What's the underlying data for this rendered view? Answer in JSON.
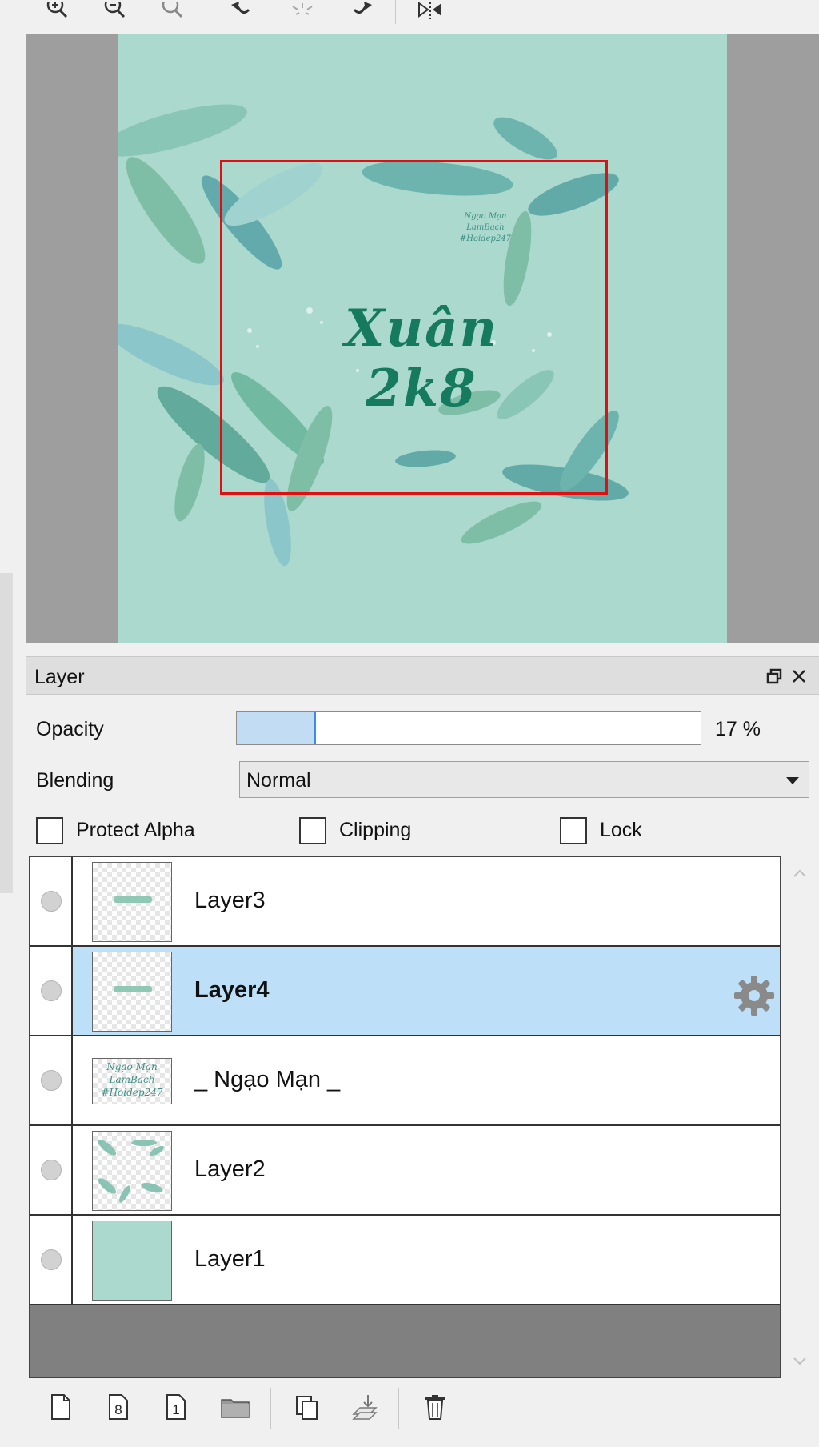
{
  "toolbar": {
    "icons": [
      "zoom-in-icon",
      "zoom-out-icon",
      "zoom-reset-icon",
      "rotate-left-icon",
      "rotate-reset-icon",
      "rotate-right-icon",
      "flip-horizontal-icon"
    ]
  },
  "canvas": {
    "artwork_title": "Xuân 2k8",
    "signature_lines": [
      "Ngạo Mạn",
      "LamBach",
      "#Hoidep247"
    ],
    "background_color": "#acd9ce",
    "navigator_frame_color": "#e01010"
  },
  "layer_panel": {
    "title": "Layer",
    "opacity_label": "Opacity",
    "opacity_value": "17 %",
    "opacity_fraction": 0.17,
    "blending_label": "Blending",
    "blending_value": "Normal",
    "protect_alpha_label": "Protect Alpha",
    "clipping_label": "Clipping",
    "lock_label": "Lock",
    "selection_color": "#bde0f8",
    "layers": [
      {
        "name": "Layer3",
        "selected": false,
        "thumb": "small-text"
      },
      {
        "name": "Layer4",
        "selected": true,
        "thumb": "small-text"
      },
      {
        "name": "_ Ngạo Mạn _",
        "selected": false,
        "thumb": "signature"
      },
      {
        "name": "Layer2",
        "selected": false,
        "thumb": "feathers"
      },
      {
        "name": "Layer1",
        "selected": false,
        "thumb": "solid"
      }
    ]
  },
  "bottom_toolbar": {
    "icons": [
      "new-layer-icon",
      "new-8bit-layer-icon",
      "new-1bit-layer-icon",
      "new-folder-icon",
      "duplicate-layer-icon",
      "merge-down-icon",
      "delete-layer-icon"
    ],
    "labels": {
      "8bit": "8",
      "1bit": "1"
    }
  }
}
